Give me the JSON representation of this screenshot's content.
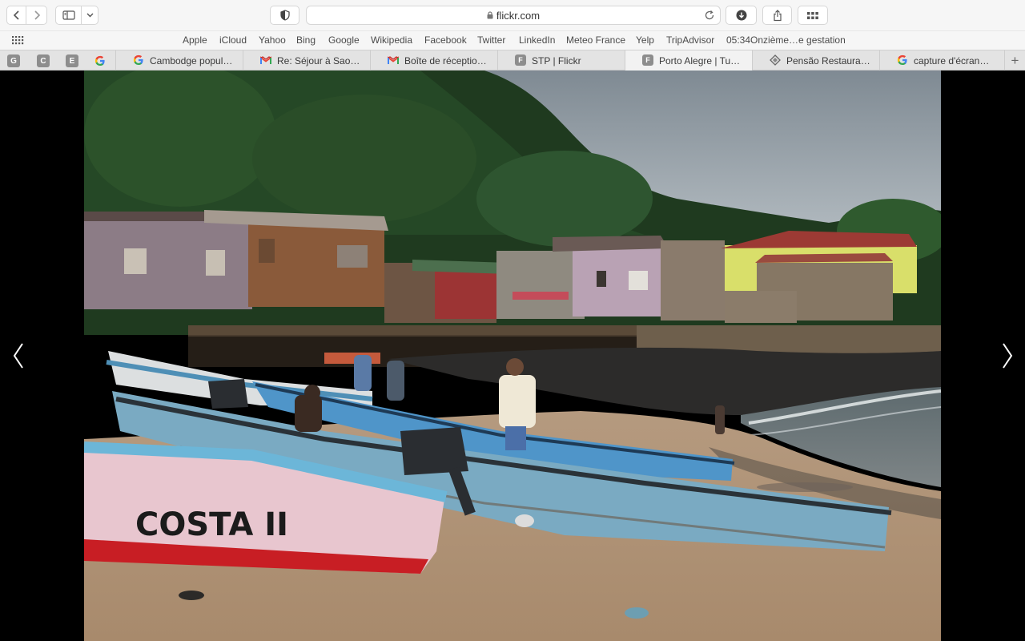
{
  "toolbar": {
    "url": "flickr.com",
    "icons": [
      "back-icon",
      "forward-icon",
      "sidebar-icon",
      "chevron-down-icon",
      "shield-icon",
      "lock-icon",
      "reload-icon",
      "download-icon",
      "share-icon",
      "tab-overview-icon"
    ]
  },
  "favorites": {
    "items": [
      "Apple",
      "iCloud",
      "Yahoo",
      "Bing",
      "Google",
      "Wikipedia",
      "Facebook",
      "Twitter",
      "LinkedIn",
      "Meteo France",
      "Yelp",
      "TripAdvisor",
      "05:34Onzième…e gestation"
    ]
  },
  "tabs": {
    "pinned": [
      "G",
      "C",
      "E"
    ],
    "items": [
      {
        "icon": "google-icon",
        "title": "Cambodge popul…"
      },
      {
        "icon": "gmail-icon",
        "title": "Re: Séjour à Sao…"
      },
      {
        "icon": "gmail-icon",
        "title": "Boîte de réceptio…"
      },
      {
        "icon": "letter-f-icon",
        "letter": "F",
        "title": "STP | Flickr"
      },
      {
        "icon": "letter-f-icon",
        "letter": "F",
        "title": "Porto Alegre | Tu…"
      },
      {
        "icon": "pensao-icon",
        "title": "Pensão Restaura…"
      },
      {
        "icon": "google-icon",
        "title": "capture d'écran…"
      }
    ],
    "new_tab": "+"
  },
  "viewer": {
    "photo_text": "COSTA II",
    "prev_icon": "chevron-left-icon",
    "next_icon": "chevron-right-icon"
  }
}
